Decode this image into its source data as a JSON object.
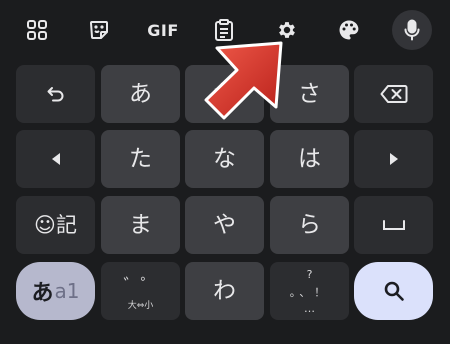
{
  "toolbar": {
    "gif_label": "GIF"
  },
  "keys": {
    "row1": {
      "center1": "あ",
      "center2": "か",
      "center3": "さ"
    },
    "row2": {
      "center1": "た",
      "center2": "な",
      "center3": "は"
    },
    "row3": {
      "kigo": "☺記",
      "center1": "ま",
      "center2": "や",
      "center3": "ら"
    },
    "row4": {
      "mode_big": "あ",
      "mode_small": "a1",
      "dakuten_marks": "゛゜",
      "dakuten_sub": "大⇔小",
      "center2": "わ",
      "punct_top": "?",
      "punct_mid": "。、！",
      "punct_bottom": "…"
    }
  },
  "icons": {
    "apps": "apps-grid-icon",
    "sticker": "sticker-icon",
    "clipboard": "clipboard-icon",
    "settings": "gear-icon",
    "theme": "palette-icon",
    "voice": "microphone-icon",
    "undo": "undo-icon",
    "backspace": "backspace-icon",
    "left": "cursor-left-icon",
    "right": "cursor-right-icon",
    "space": "space-icon",
    "search": "search-icon",
    "pointer": "red-arrow-icon"
  },
  "colors": {
    "background": "#1b1c1e",
    "key": "#3e3f43",
    "func_key": "#2c2d30",
    "mode_key": "#b6b8cd",
    "search_key": "#dbe1fb",
    "arrow": "#e0322a"
  }
}
